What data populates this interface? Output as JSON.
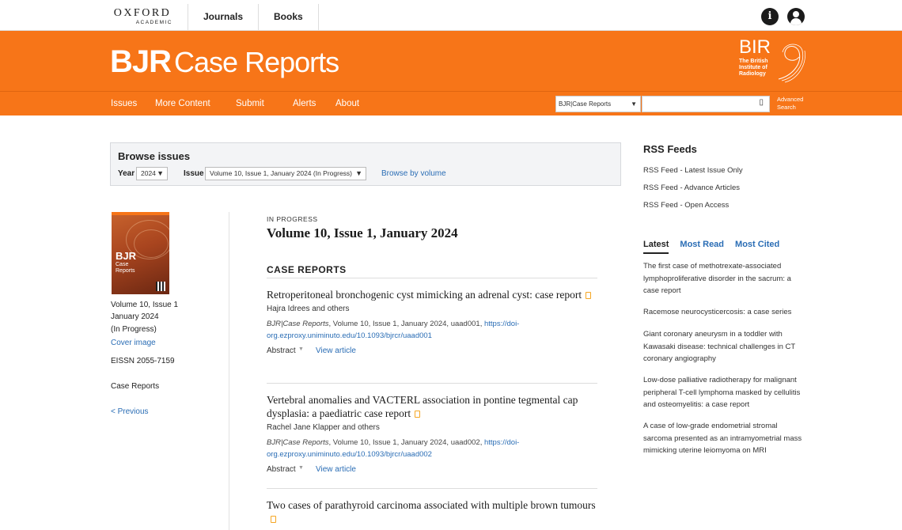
{
  "header": {
    "publisher_line1": "OXFORD",
    "publisher_line2": "ACADEMIC",
    "nav": [
      "Journals",
      "Books"
    ],
    "info_icon": "info-icon",
    "account_icon": "user-account-icon"
  },
  "banner": {
    "brand_bold": "BJR",
    "brand_light": "Case Reports",
    "society_letters": "BIR",
    "society_name_lines": [
      "The British",
      "Institute of",
      "Radiology"
    ],
    "bg_color": "#f77518"
  },
  "nav": {
    "items": [
      "Issues",
      "More Content",
      "Submit",
      "Alerts",
      "About"
    ],
    "search_scope": "BJR|Case Reports",
    "search_placeholder": "",
    "advanced_line1": "Advanced",
    "advanced_line2": "Search"
  },
  "browse": {
    "title": "Browse issues",
    "year_label": "Year",
    "year_value": "2024",
    "issue_label": "Issue",
    "issue_value": "Volume 10, Issue 1, January 2024 (In Progress)",
    "by_volume": "Browse by volume"
  },
  "left": {
    "cover_title": "BJR",
    "cover_sub1": "Case",
    "cover_sub2": "Reports",
    "vol_line1": "Volume 10, Issue 1",
    "vol_line2": "January 2024",
    "vol_line3": "(In Progress)",
    "cover_link": "Cover image",
    "eissn": "EISSN 2055-7159",
    "category": "Case Reports",
    "previous": "< Previous"
  },
  "main": {
    "status": "IN PROGRESS",
    "issue_title": "Volume 10, Issue 1, January 2024",
    "section": "CASE REPORTS",
    "articles": [
      {
        "title": "Retroperitoneal bronchogenic cyst mimicking an adrenal cyst: case report",
        "authors": "Hajra Idrees and others",
        "journal": "BJR|Case Reports",
        "citation": ", Volume 10, Issue 1, January 2024, uaad001, ",
        "doi_line1": "https://doi-",
        "doi_line2": "org.ezproxy.uniminuto.edu/10.1093/bjrcr/uaad001",
        "abstract": "Abstract",
        "view": "View article"
      },
      {
        "title": "Vertebral anomalies and VACTERL association in pontine tegmental cap dysplasia: a paediatric case report",
        "authors": "Rachel Jane Klapper and others",
        "journal": "BJR|Case Reports",
        "citation": ", Volume 10, Issue 1, January 2024, uaad002, ",
        "doi_line1": "https://doi-",
        "doi_line2": "org.ezproxy.uniminuto.edu/10.1093/bjrcr/uaad002",
        "abstract": "Abstract",
        "view": "View article"
      },
      {
        "title": "Two cases of parathyroid carcinoma associated with multiple brown tumours"
      }
    ]
  },
  "right": {
    "rss_title": "RSS Feeds",
    "rss_items": [
      "RSS Feed - Latest Issue Only",
      "RSS Feed - Advance Articles",
      "RSS Feed - Open Access"
    ],
    "tabs": [
      "Latest",
      "Most Read",
      "Most Cited"
    ],
    "latest": [
      "The first case of methotrexate-associated lymphoproliferative disorder in the sacrum: a case report",
      "Racemose neurocysticercosis: a case series",
      "Giant coronary aneurysm in a toddler with Kawasaki disease: technical challenges in CT coronary angiography",
      "Low-dose palliative radiotherapy for malignant peripheral T-cell lymphoma masked by cellulitis and osteomyelitis: a case report",
      "A case of low-grade endometrial stromal sarcoma presented as an intramyometrial mass mimicking uterine leiomyoma on MRI"
    ]
  }
}
